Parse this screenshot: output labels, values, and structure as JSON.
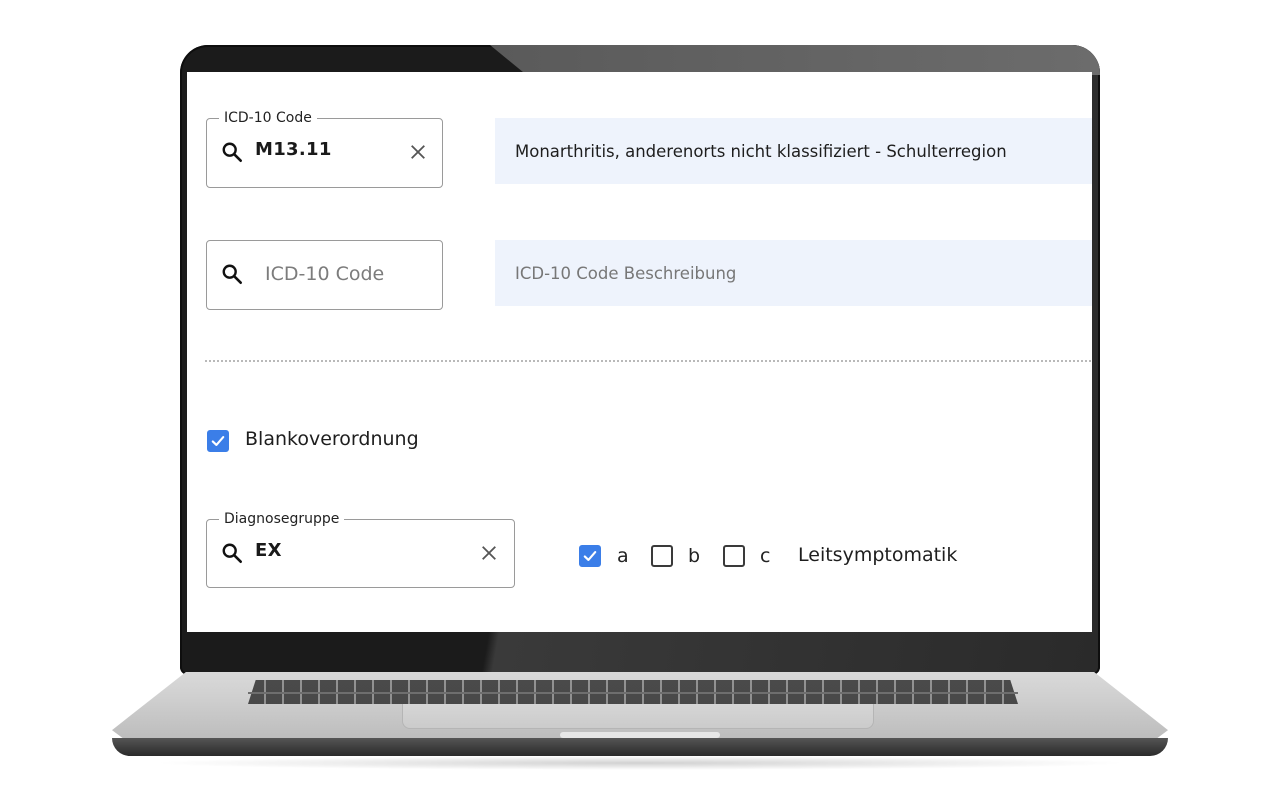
{
  "icd_field_1": {
    "legend": "ICD-10 Code",
    "value": "M13.11",
    "description": "Monarthritis, anderenorts nicht klassifiziert - Schulterregion"
  },
  "icd_field_2": {
    "placeholder": "ICD-10 Code",
    "description_placeholder": "ICD-10 Code Beschreibung"
  },
  "blanko": {
    "label": "Blankoverordnung",
    "checked": true
  },
  "diagnosegruppe": {
    "legend": "Diagnosegruppe",
    "value": "EX"
  },
  "leitsymptomatik": {
    "options": [
      {
        "label": "a",
        "checked": true
      },
      {
        "label": "b",
        "checked": false
      },
      {
        "label": "c",
        "checked": false
      }
    ],
    "label": "Leitsymptomatik"
  },
  "icons": {
    "search": "search-icon",
    "clear": "close-icon",
    "check": "check-icon"
  },
  "colors": {
    "accent": "#3b7ee8",
    "description_bg": "#eef3fc"
  }
}
